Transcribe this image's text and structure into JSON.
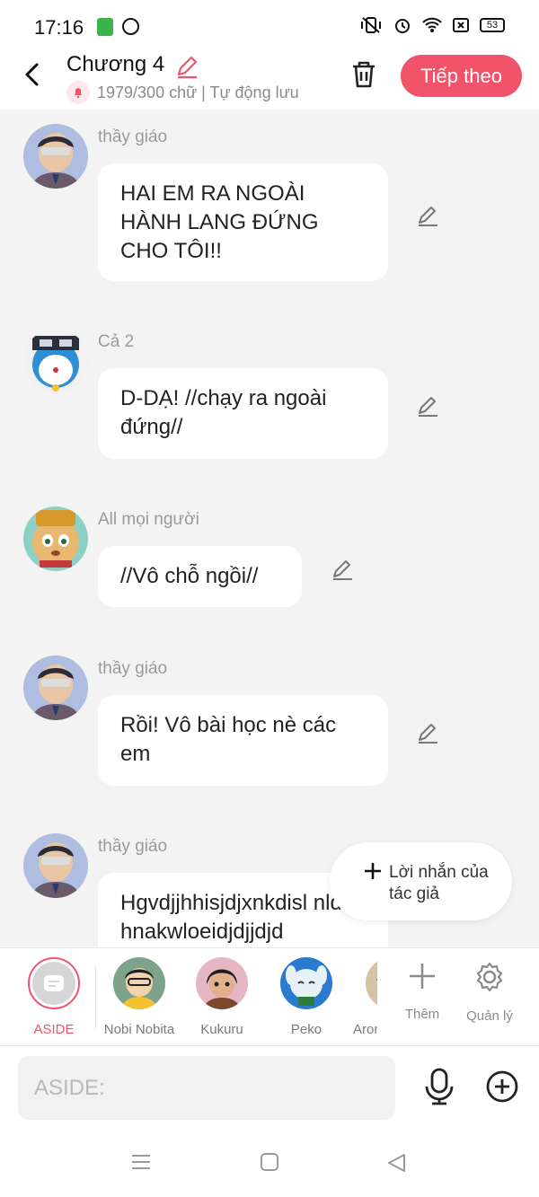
{
  "status_bar": {
    "time": "17:16",
    "battery": "53",
    "icons": [
      "app-icon",
      "pinterest-icon",
      "mute-vibrate-icon",
      "alarm-icon",
      "wifi-icon",
      "sim-icon",
      "battery-icon"
    ]
  },
  "header": {
    "title": "Chương 4",
    "subtitle": "1979/300 chữ | Tự động lưu",
    "next_label": "Tiếp theo"
  },
  "messages": [
    {
      "sender": "thầy giáo",
      "text": "HAI EM RA NGOÀI HÀNH LANG ĐỨNG CHO TÔI!!"
    },
    {
      "sender": "Cả 2",
      "text": "D-DẠ! //chạy ra ngoài đứng//"
    },
    {
      "sender": "All mọi người",
      "text": "//Vô chỗ ngồi//"
    },
    {
      "sender": "thầy giáo",
      "text": "Rồi! Vô bài học nè các em"
    },
    {
      "sender": "thầy giáo",
      "text": "Hgvdjjhhisjdjxnkdisl nldofhnakwloeidjdjjdjd"
    }
  ],
  "author_note": {
    "label": "Lời nhắn của tác giả"
  },
  "characters": [
    {
      "name": "ASIDE"
    },
    {
      "name": "Nobi Nobita"
    },
    {
      "name": "Kukuru"
    },
    {
      "name": "Peko"
    },
    {
      "name": "Aron"
    }
  ],
  "tools": {
    "add_label": "Thêm",
    "manage_label": "Quản lý"
  },
  "input": {
    "placeholder": "ASIDE:"
  },
  "colors": {
    "accent": "#f2536b",
    "background": "#f3f3f3",
    "bubble": "#ffffff",
    "muted_text": "#9a9a9a"
  }
}
